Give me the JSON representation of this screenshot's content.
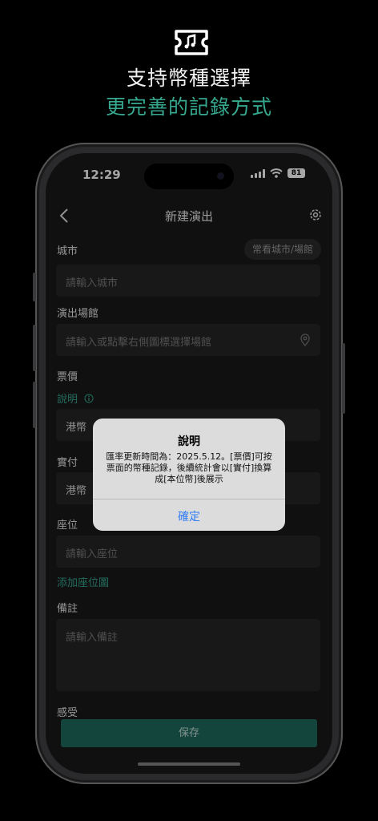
{
  "promo": {
    "title": "支持幣種選擇",
    "subtitle": "更完善的記錄方式"
  },
  "status": {
    "time": "12:29",
    "battery": "81"
  },
  "nav": {
    "title": "新建演出"
  },
  "form": {
    "city_label": "城市",
    "city_chip": "常看城市/場館",
    "city_placeholder": "請輸入城市",
    "venue_label": "演出場館",
    "venue_placeholder": "請輸入或點擊右側圖標選擇場館",
    "price_label": "票價",
    "note_link": "說明",
    "price_currency": "港幣",
    "paid_label": "實付",
    "paid_currency": "港幣",
    "seat_label": "座位",
    "seat_placeholder": "請輸入座位",
    "add_seat_map": "添加座位圖",
    "remark_label": "備註",
    "remark_placeholder": "請輸入備註",
    "feeling_label": "感受",
    "save_label": "保存"
  },
  "alert": {
    "title": "說明",
    "message": "匯率更新時間為：2025.5.12。[票價]可按票面的幣種記錄，後續統計會以[實付]換算成[本位幣]後展示",
    "confirm_label": "確定"
  },
  "colors": {
    "accent": "#36a88f",
    "button": "#1e6b5c",
    "alert_link": "#2f7cf6"
  }
}
